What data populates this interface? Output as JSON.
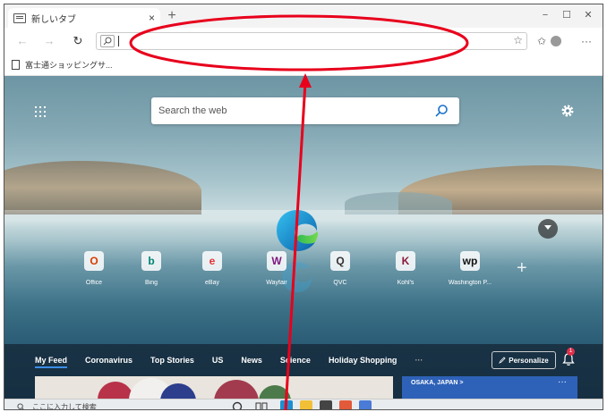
{
  "tab": {
    "title": "新しいタブ",
    "close": "×",
    "new_tab": "+"
  },
  "window": {
    "minimize": "−",
    "maximize": "☐",
    "close": "✕"
  },
  "toolbar": {
    "back": "←",
    "forward": "→",
    "refresh": "↻",
    "address_value": "",
    "favorite_star": "☆",
    "favorites": "✩",
    "more": "···"
  },
  "favorites_bar": {
    "items": [
      {
        "label": "富士通ショッピングサ..."
      }
    ]
  },
  "ntp": {
    "search_placeholder": "Search the web",
    "tiles": [
      {
        "label": "Office",
        "icon": "office-icon",
        "color": "#d83b01",
        "glyph": "O"
      },
      {
        "label": "Bing",
        "icon": "bing-icon",
        "color": "#008373",
        "glyph": "b"
      },
      {
        "label": "eBay",
        "icon": "ebay-icon",
        "color": "#e53238",
        "glyph": "e"
      },
      {
        "label": "Wayfair",
        "icon": "wayfair-icon",
        "color": "#7f187f",
        "glyph": "W"
      },
      {
        "label": "QVC",
        "icon": "qvc-icon",
        "color": "#333333",
        "glyph": "Q"
      },
      {
        "label": "Kohl's",
        "icon": "kohls-icon",
        "color": "#8b1a3a",
        "glyph": "K"
      },
      {
        "label": "Washington P...",
        "icon": "washington-post-icon",
        "color": "#111111",
        "glyph": "wp"
      }
    ],
    "add_tile": "+"
  },
  "feed": {
    "nav": [
      "My Feed",
      "Coronavirus",
      "Top Stories",
      "US",
      "News",
      "Science",
      "Holiday Shopping"
    ],
    "more": "···",
    "personalize_label": "Personalize",
    "notification_count": "1",
    "weather_location": "OSAKA, JAPAN  >",
    "weather_menu": "···"
  },
  "taskbar": {
    "search_placeholder": "ここに入力して検索",
    "apps": [
      {
        "icon": "edge-icon",
        "color": "#1f8fd0"
      },
      {
        "icon": "file-explorer-icon",
        "color": "#f2c037"
      },
      {
        "icon": "store-icon",
        "color": "#444444"
      },
      {
        "icon": "office-icon",
        "color": "#e25a3a"
      },
      {
        "icon": "app-icon",
        "color": "#4a7bd6"
      }
    ]
  },
  "annotation": {
    "color": "#e8001c"
  }
}
